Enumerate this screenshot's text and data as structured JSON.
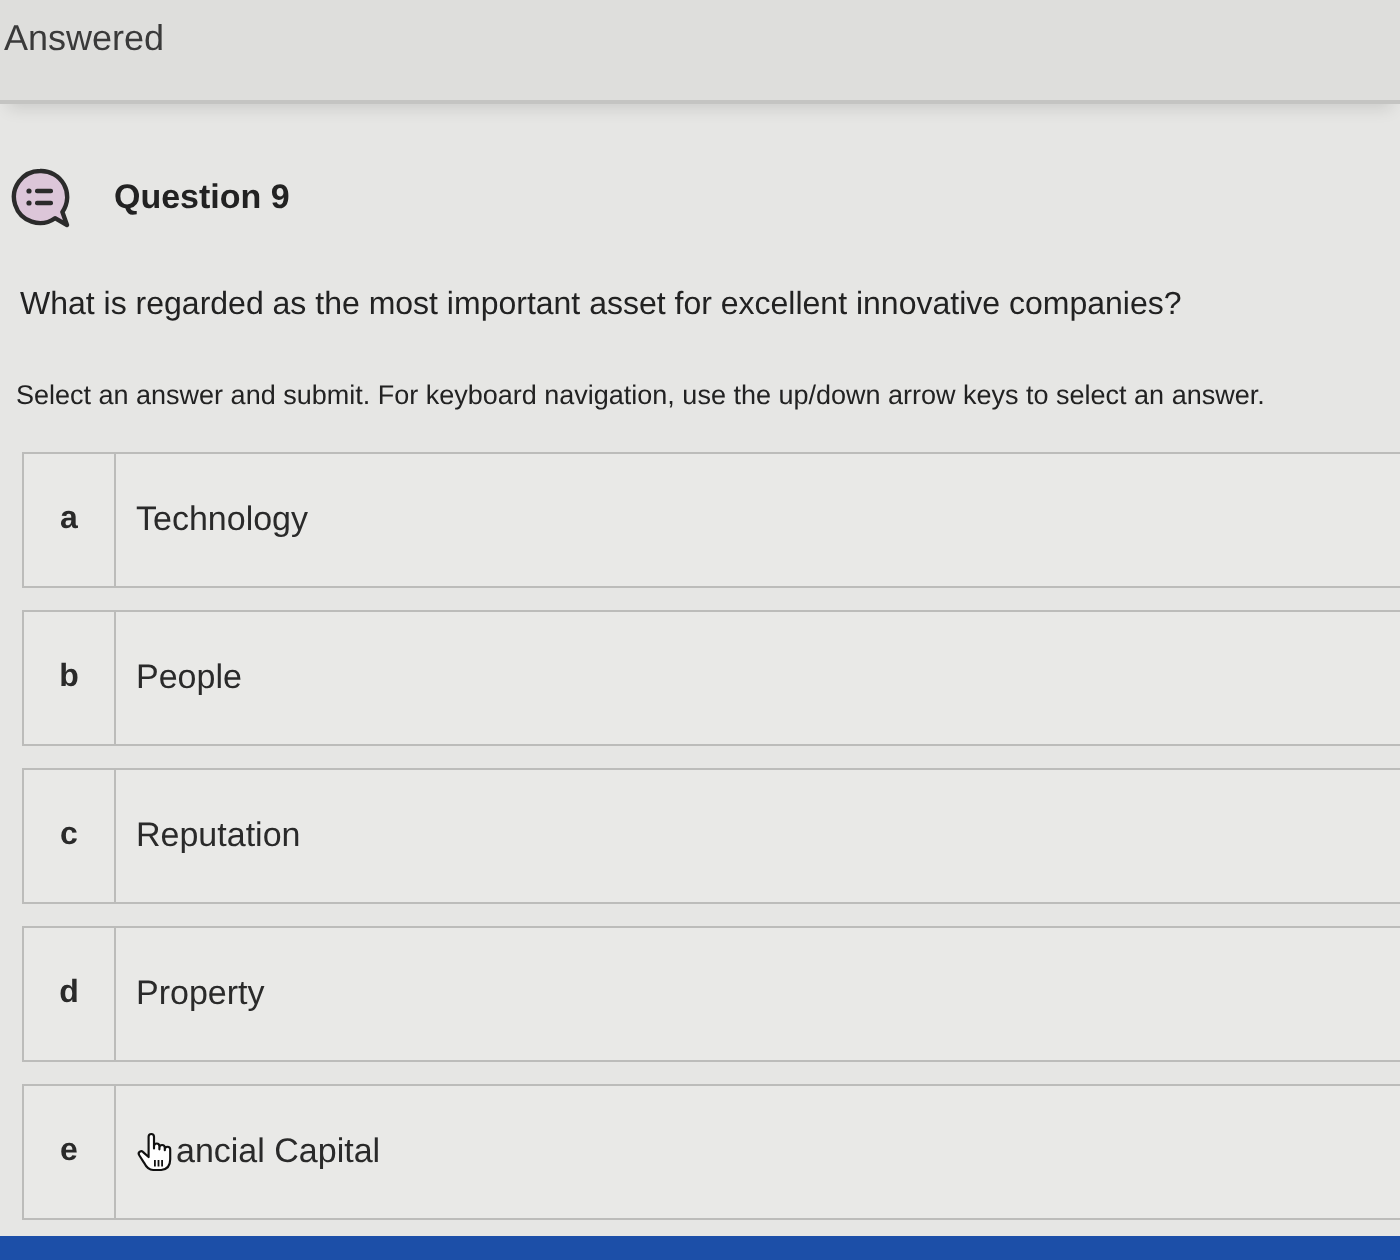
{
  "header": {
    "status": "Answered"
  },
  "question": {
    "title": "Question 9",
    "text": "What is regarded as the most important asset for excellent innovative companies?",
    "instructions": "Select an answer and submit. For keyboard navigation, use the up/down arrow keys to select an answer."
  },
  "options": [
    {
      "letter": "a",
      "label": "Technology",
      "selected": false,
      "hovered": false
    },
    {
      "letter": "b",
      "label": "People",
      "selected": false,
      "hovered": false
    },
    {
      "letter": "c",
      "label": "Reputation",
      "selected": false,
      "hovered": false
    },
    {
      "letter": "d",
      "label": "Property",
      "selected": false,
      "hovered": false
    },
    {
      "letter": "e",
      "label": "ancial Capital",
      "selected": false,
      "hovered": true
    }
  ]
}
